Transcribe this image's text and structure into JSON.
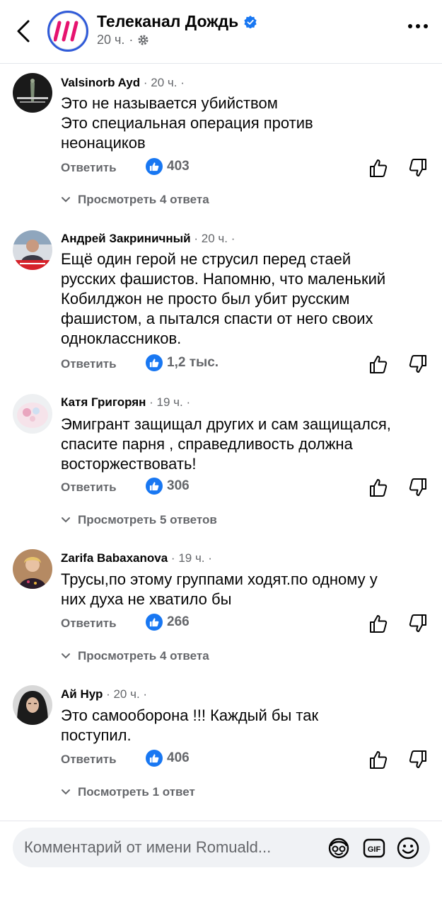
{
  "header": {
    "channel_name": "Телеканал Дождь",
    "post_time": "20 ч.",
    "separator": "·"
  },
  "comments": [
    {
      "author": "Valsinorb Ayd",
      "time": "20 ч.",
      "lines": [
        "Это не называется убийством",
        "Это специальная операция против",
        "неонациков"
      ],
      "reply_label": "Ответить",
      "likes": "403",
      "view_replies": "Просмотреть 4 ответа"
    },
    {
      "author": "Андрей Закриничный",
      "time": "20 ч.",
      "lines": [
        "Ещё один герой не струсил перед стаей",
        "русских фашистов. Напомню, что маленький",
        "Кобилджон не просто был убит русским",
        "фашистом, а пытался спасти от него своих",
        "одноклассников."
      ],
      "reply_label": "Ответить",
      "likes": "1,2 тыс."
    },
    {
      "author": "Катя Григорян",
      "time": "19 ч.",
      "lines": [
        "Эмигрант защищал других и сам защищался,",
        "спасите парня ,  справедливость должна",
        "восторжествовать!"
      ],
      "reply_label": "Ответить",
      "likes": "306",
      "view_replies": "Просмотреть 5 ответов"
    },
    {
      "author": "Zarifa Babaxanova",
      "time": "19 ч.",
      "lines": [
        "Трусы,по этому группами ходят.по одному у",
        "них духа не хватило бы"
      ],
      "reply_label": "Ответить",
      "likes": "266",
      "view_replies": "Просмотреть 4 ответа"
    },
    {
      "author": "Ай Нур",
      "time": "20 ч.",
      "lines": [
        "Это самооборона  !!! Каждый бы так",
        "поступил."
      ],
      "reply_label": "Ответить",
      "likes": "406",
      "view_replies": "Посмотреть 1 ответ"
    }
  ],
  "composer": {
    "placeholder": "Комментарий от имени Romuald...",
    "icons": [
      "avatar-sticker-icon",
      "gif-icon",
      "emoji-icon"
    ]
  },
  "colors": {
    "like_blue": "#1877f2",
    "secondary_text": "#65676b",
    "brand_blue": "#2f5ad8",
    "brand_pink": "#e6136f"
  }
}
